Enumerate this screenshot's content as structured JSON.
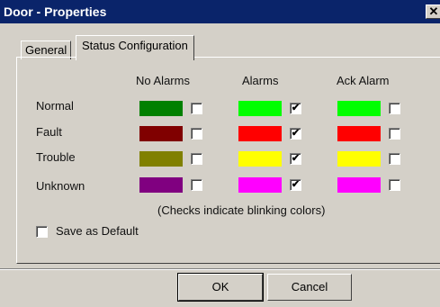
{
  "window": {
    "title": "Door - Properties",
    "close_glyph": "✕"
  },
  "tabs": [
    {
      "label": "General"
    },
    {
      "label": "Status Configuration"
    }
  ],
  "columns": [
    {
      "label": "No Alarms"
    },
    {
      "label": "Alarms"
    },
    {
      "label": "Ack Alarm"
    }
  ],
  "rows": [
    {
      "label": "Normal",
      "colors": [
        "#008000",
        "#00ff00",
        "#00ff00"
      ],
      "blink": [
        false,
        true,
        false
      ]
    },
    {
      "label": "Fault",
      "colors": [
        "#800000",
        "#ff0000",
        "#ff0000"
      ],
      "blink": [
        false,
        true,
        false
      ]
    },
    {
      "label": "Trouble",
      "colors": [
        "#808000",
        "#ffff00",
        "#ffff00"
      ],
      "blink": [
        false,
        true,
        false
      ]
    },
    {
      "label": "Unknown",
      "colors": [
        "#800080",
        "#ff00ff",
        "#ff00ff"
      ],
      "blink": [
        false,
        true,
        false
      ]
    }
  ],
  "note": "(Checks indicate blinking colors)",
  "save_default": {
    "label": "Save as Default",
    "checked": false
  },
  "buttons": {
    "ok": "OK",
    "cancel": "Cancel"
  },
  "check_glyph": "✔"
}
